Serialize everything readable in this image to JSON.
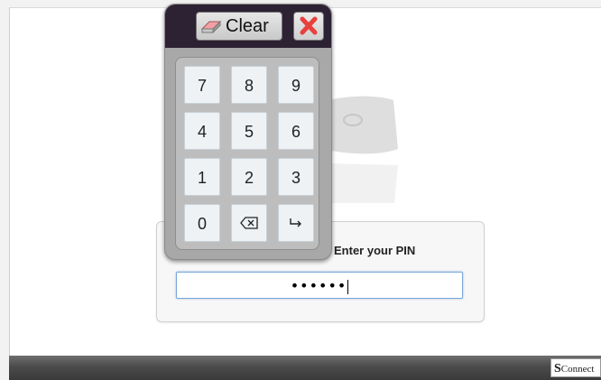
{
  "keypad": {
    "clear_label": "Clear",
    "keys": [
      "7",
      "8",
      "9",
      "4",
      "5",
      "6",
      "1",
      "2",
      "3",
      "0"
    ],
    "icons": {
      "eraser": "eraser-icon",
      "close": "close-x-icon",
      "backspace": "backspace-icon",
      "enter": "enter-arrow-icon"
    },
    "colors": {
      "header": "#2c2233",
      "close_x": "#e8403c"
    }
  },
  "pin": {
    "label": "Enter your PIN",
    "masked_value": "••••••"
  },
  "footer": {
    "brand_initial": "S",
    "brand_text": "Connect"
  }
}
